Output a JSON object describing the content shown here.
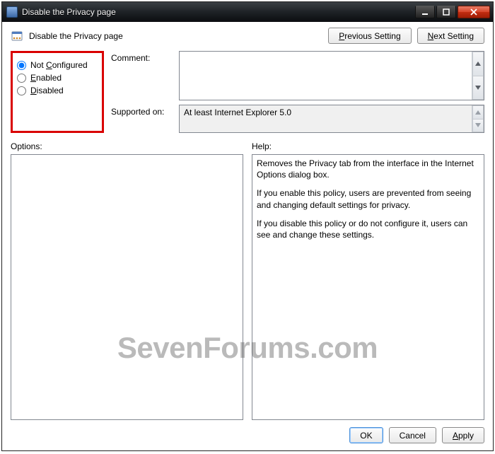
{
  "window": {
    "title": "Disable the Privacy page"
  },
  "policy": {
    "name": "Disable the Privacy page"
  },
  "nav": {
    "previous": "Previous Setting",
    "next": "Next Setting"
  },
  "radios": {
    "not_configured": "Not Configured",
    "enabled": "Enabled",
    "disabled": "Disabled",
    "selected": "not_configured"
  },
  "fields": {
    "comment_label": "Comment:",
    "comment_value": "",
    "supported_label": "Supported on:",
    "supported_value": "At least Internet Explorer 5.0"
  },
  "sections": {
    "options_label": "Options:",
    "help_label": "Help:"
  },
  "help_text": {
    "p1": "Removes the Privacy tab from the interface in the Internet Options dialog box.",
    "p2": "If you enable this policy, users are prevented from seeing and changing default settings for privacy.",
    "p3": "If you disable this policy or do not configure it, users can see and change these settings."
  },
  "buttons": {
    "ok": "OK",
    "cancel": "Cancel",
    "apply": "Apply"
  },
  "watermark": "SevenForums.com",
  "underline": {
    "previous": "P",
    "next": "N",
    "not_configured": "C",
    "enabled": "E",
    "disabled": "D",
    "apply": "A"
  }
}
